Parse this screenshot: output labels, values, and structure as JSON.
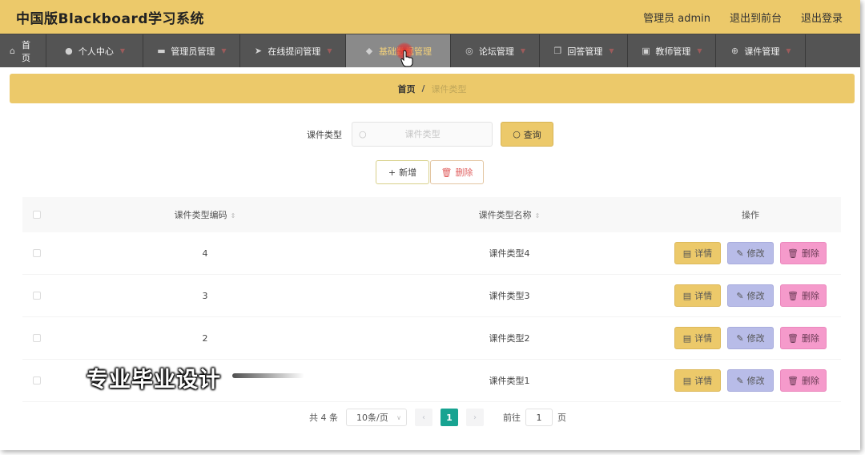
{
  "header": {
    "title": "中国版Blackboard学习系统",
    "user": "管理员 admin",
    "front": "退出到前台",
    "logout": "退出登录"
  },
  "nav": [
    {
      "label": "首页",
      "icon": "home-icon",
      "glyph": "⌂"
    },
    {
      "label": "个人中心",
      "icon": "user-icon",
      "glyph": "●"
    },
    {
      "label": "管理员管理",
      "icon": "box-icon",
      "glyph": "▬"
    },
    {
      "label": "在线提问管理",
      "icon": "send-icon",
      "glyph": "➤"
    },
    {
      "label": "基础数据管理",
      "icon": "shield-icon",
      "glyph": "◆"
    },
    {
      "label": "论坛管理",
      "icon": "forum-icon",
      "glyph": "◎"
    },
    {
      "label": "回答管理",
      "icon": "document-icon",
      "glyph": "❐"
    },
    {
      "label": "教师管理",
      "icon": "teacher-icon",
      "glyph": "▣"
    },
    {
      "label": "课件管理",
      "icon": "target-icon",
      "glyph": "⊕"
    }
  ],
  "breadcrumb": {
    "home": "首页",
    "sep": "/",
    "current": "课件类型"
  },
  "search": {
    "label": "课件类型",
    "placeholder": "课件类型",
    "button": "查询"
  },
  "actions": {
    "add": "新增",
    "delete": "删除"
  },
  "table": {
    "headers": {
      "code": "课件类型编码",
      "name": "课件类型名称",
      "op": "操作"
    },
    "rows": [
      {
        "code": "4",
        "name": "课件类型4"
      },
      {
        "code": "3",
        "name": "课件类型3"
      },
      {
        "code": "2",
        "name": "课件类型2"
      },
      {
        "code": "",
        "name": "课件类型1"
      }
    ],
    "row_actions": {
      "detail": "详情",
      "edit": "修改",
      "delete": "删除"
    }
  },
  "pagination": {
    "total": "共 4 条",
    "size": "10条/页",
    "page": "1",
    "goto": "前往",
    "goto_value": "1",
    "unit": "页"
  },
  "watermark": "专业毕业设计",
  "colors": {
    "accent": "#ecc96a",
    "nav": "#545454",
    "page_active": "#17a391",
    "edit": "#b8bce8",
    "delete": "#f59acb"
  }
}
